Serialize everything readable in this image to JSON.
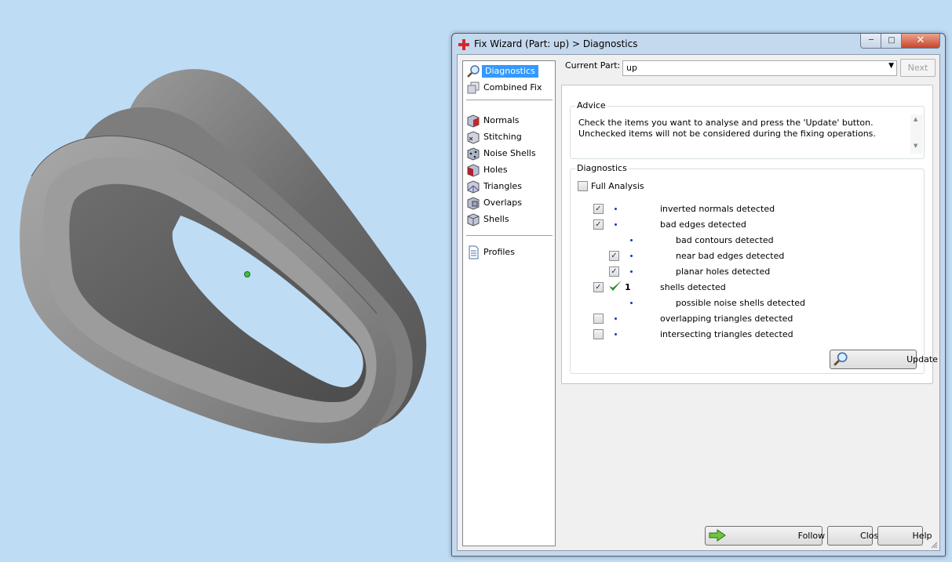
{
  "window": {
    "title": "Fix Wizard (Part: up) > Diagnostics",
    "minimize_glyph": "─",
    "maximize_glyph": "□",
    "close_glyph": "✕"
  },
  "nav": {
    "items": [
      {
        "label": "Diagnostics",
        "icon": "magnifier-icon",
        "selected": true
      },
      {
        "label": "Combined Fix",
        "icon": "combined-fix-icon"
      },
      {
        "label": "Normals",
        "icon": "normals-cube-icon"
      },
      {
        "label": "Stitching",
        "icon": "stitching-cube-icon"
      },
      {
        "label": "Noise Shells",
        "icon": "noise-shells-cube-icon"
      },
      {
        "label": "Holes",
        "icon": "holes-cube-icon"
      },
      {
        "label": "Triangles",
        "icon": "triangles-cube-icon"
      },
      {
        "label": "Overlaps",
        "icon": "overlaps-cube-icon"
      },
      {
        "label": "Shells",
        "icon": "shells-cube-icon"
      },
      {
        "label": "Profiles",
        "icon": "profiles-document-icon"
      }
    ]
  },
  "current_part": {
    "label": "Current Part:",
    "value": "up",
    "next_label": "Next"
  },
  "advice": {
    "title": "Advice",
    "text": "Check the items you want to analyse and press the 'Update' button. Unchecked items will not be considered during the fixing operations."
  },
  "diagnostics": {
    "title": "Diagnostics",
    "full_analysis_label": "Full Analysis",
    "full_analysis_checked": false,
    "items": [
      {
        "label": "inverted normals detected",
        "checked": true,
        "level": 0
      },
      {
        "label": "bad edges detected",
        "checked": true,
        "level": 0
      },
      {
        "label": "bad contours detected",
        "checked": null,
        "level": 1
      },
      {
        "label": "near bad edges detected",
        "checked": true,
        "level": 1
      },
      {
        "label": "planar holes detected",
        "checked": true,
        "level": 1
      },
      {
        "label": "shells detected",
        "checked": true,
        "level": 0,
        "ok": true,
        "count": "1"
      },
      {
        "label": "possible noise shells detected",
        "checked": null,
        "level": 1
      },
      {
        "label": "overlapping triangles detected",
        "checked": false,
        "level": 0
      },
      {
        "label": "intersecting triangles detected",
        "checked": false,
        "level": 0
      }
    ],
    "update_label": "Update"
  },
  "footer": {
    "follow_advice_label": "Follow Advice",
    "close_label": "Close",
    "help_label": "Help"
  },
  "colors": {
    "viewport_background": "#bfdcf5",
    "selection": "#3399ff",
    "check_ok": "#2e8b2e",
    "model_gray": "#8a8a8a"
  }
}
